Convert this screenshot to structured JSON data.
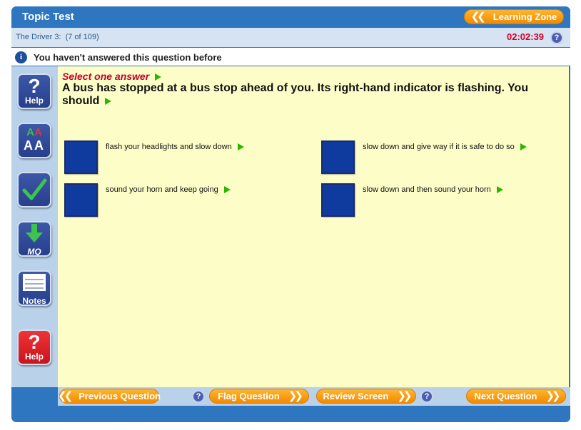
{
  "app": {
    "title": "Topic Test"
  },
  "header": {
    "learning_zone": "Learning Zone"
  },
  "info": {
    "subject": "The Driver 3:",
    "progress": "(7 of 109)",
    "timer": "02:02:39"
  },
  "status": {
    "message": "You haven't answered this question before"
  },
  "sidebar": {
    "help_label": "Help",
    "font_glyph_top": "AA",
    "font_glyph_bottom": "AA",
    "mq_label": "MQ",
    "notes_label": "Notes",
    "help2_label": "Help"
  },
  "question": {
    "instruction": "Select one answer",
    "text": "A bus has stopped at a bus stop ahead of you. Its right-hand indicator is flashing. You should"
  },
  "answers": [
    "flash your headlights and slow down",
    "slow down and give way if it is safe to do so",
    "sound your horn and keep going",
    "slow down and then sound your horn"
  ],
  "nav": {
    "previous": "Previous Question",
    "flag": "Flag Question",
    "review": "Review Screen",
    "next": "Next Question"
  },
  "colors": {
    "frame": "#2f76c0",
    "accent_orange": "#f28a00",
    "content_bg": "#fdfdc8",
    "answer_box": "#0f3a9e",
    "timer": "#d4002a"
  }
}
